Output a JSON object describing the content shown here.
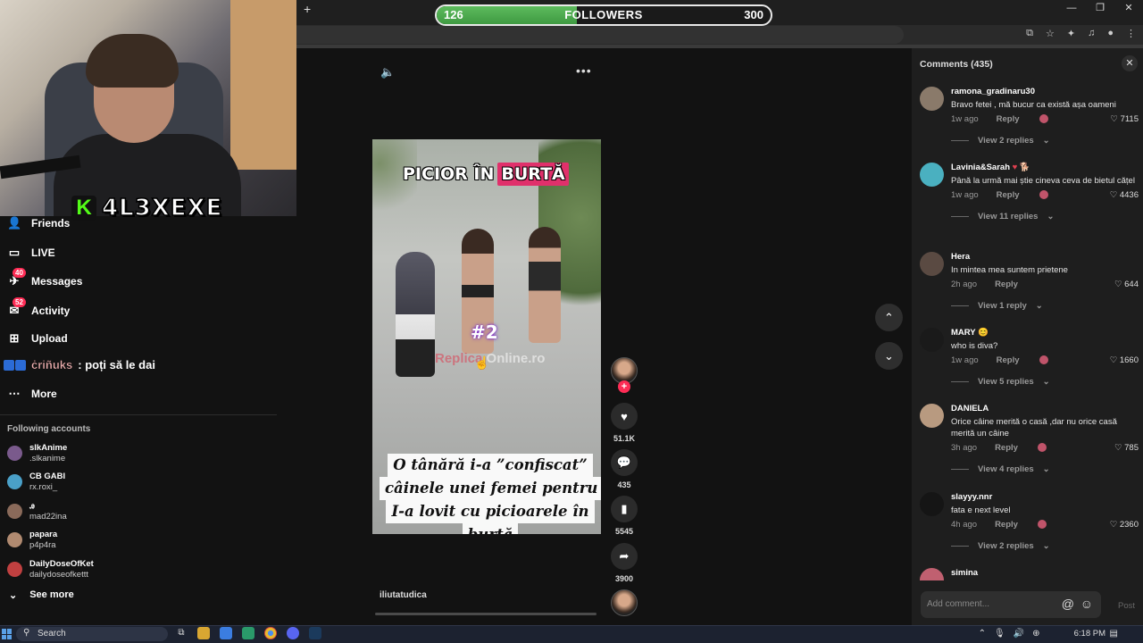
{
  "browser": {
    "new_tab": "+",
    "window_controls": [
      "—",
      "❐",
      "✕"
    ],
    "toolbar_icons": [
      "cast-icon",
      "star-icon",
      "extensions-icon",
      "media-icon",
      "profile-icon",
      "menu-icon"
    ]
  },
  "overlay": {
    "followers_current": "126",
    "followers_label": "FOLLOWERS",
    "followers_goal": "300",
    "followers_progress_percent": 42
  },
  "stream": {
    "kick_logo": "K",
    "streamer_name": "4L3XEXE"
  },
  "nav": {
    "friends": "Friends",
    "live": "LIVE",
    "messages": "Messages",
    "messages_badge": "40",
    "activity": "Activity",
    "activity_badge": "52",
    "upload": "Upload",
    "more": "More"
  },
  "chat": {
    "user": "ċriñuks",
    "message": ": poți să le dai"
  },
  "following": {
    "title": "Following accounts",
    "accounts": [
      {
        "name": "slkAnime",
        "handle": ".slkanime",
        "color": "#7a5a8c"
      },
      {
        "name": "CB GABI",
        "handle": "rx.roxi_",
        "color": "#4aa0c8"
      },
      {
        "name": "ꭿ",
        "handle": "mad22ina",
        "color": "#8a6a5a"
      },
      {
        "name": "papara",
        "handle": "p4p4ra",
        "color": "#b08a70"
      },
      {
        "name": "DailyDoseOfKet",
        "handle": "dailydoseofkettt",
        "color": "#c04040"
      }
    ],
    "see_more": "See more"
  },
  "video": {
    "title_part1": "PICIOR ÎN",
    "title_part2": "BURTĂ",
    "episode": "#2",
    "watermark_a": "Replica",
    "watermark_b": " Online.ro",
    "caption_lines": [
      "O tânără i-a ”confiscat”",
      "câinele unei femei pentru c",
      "I-a lovit cu picioarele în",
      "burtă"
    ],
    "author": "iliutatudica",
    "progress_percent": 0,
    "likes": "51.1K",
    "comments": "435",
    "saves": "5545",
    "shares": "3900",
    "follow_plus": "+"
  },
  "comments": {
    "title": "Comments (435)",
    "close": "✕",
    "items": [
      {
        "user": "ramona_gradinaru30",
        "text": "Bravo fetei , mă bucur ca există așa oameni",
        "time": "1w ago",
        "reply": "Reply",
        "likes": "7115",
        "view": "View 2 replies",
        "color": "#8a7a6a"
      },
      {
        "user": "Lavinia&Sarah",
        "user_suffix": " ♥ 🐕",
        "text": "Până la urmă mai știe cineva ceva de bietul cățel",
        "time": "1w ago",
        "reply": "Reply",
        "likes": "4436",
        "view": "View 11 replies",
        "color": "#4ab0c0"
      },
      {
        "user": "Hera",
        "text": "In mintea mea suntem prietene",
        "time": "2h ago",
        "reply": "Reply",
        "likes": "644",
        "view": "View 1 reply",
        "color": "#5a4a42"
      },
      {
        "user": "MARY",
        "user_suffix": " 😊",
        "text": "who is diva?",
        "time": "1w ago",
        "reply": "Reply",
        "likes": "1660",
        "view": "View 5 replies",
        "color": "#1a1a1a"
      },
      {
        "user": "DANIELA",
        "text": "Orice câine merită o casă ,dar nu orice casă merită un câine",
        "time": "3h ago",
        "reply": "Reply",
        "likes": "785",
        "view": "View 4 replies",
        "color": "#b89a80"
      },
      {
        "user": "slayyy.nnr",
        "text": "fata e next level",
        "time": "4h ago",
        "reply": "Reply",
        "likes": "2360",
        "view": "View 2 replies",
        "color": "#151515"
      },
      {
        "user": "simina",
        "color": "#c06070"
      }
    ],
    "input_placeholder": "Add comment...",
    "at_icon": "@",
    "emoji_icon": "☺",
    "post": "Post"
  },
  "taskbar": {
    "search": "Search",
    "time": "6:18 PM"
  }
}
